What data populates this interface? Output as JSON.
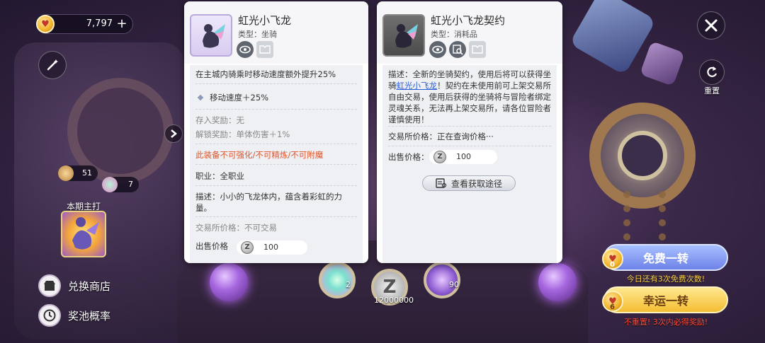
{
  "currency": {
    "icon": "cat-coin-icon",
    "value": "7,797",
    "plus": "+"
  },
  "top_right": {
    "reset_label": "重置"
  },
  "left_side": {
    "badge_a": "51",
    "badge_b": "7",
    "featured_label": "本期主打",
    "menu": [
      {
        "label": "兑换商店",
        "icon": "shop-icon"
      },
      {
        "label": "奖池概率",
        "icon": "clock-icon"
      }
    ]
  },
  "rewards": [
    {
      "label": "2",
      "icon": "rainbow-dragon-egg-icon"
    },
    {
      "label": "12000000",
      "icon": "z-coin-icon"
    },
    {
      "label": "90",
      "icon": "crystal-icon"
    }
  ],
  "spin": {
    "free_label": "免费一转",
    "free_count": "0",
    "free_hint": "今日还有3次免费次数!",
    "lucky_label": "幸运一转",
    "lucky_count": "6",
    "lucky_hint": "不重置! 3次内必得奖励!"
  },
  "panel_left": {
    "name": "虹光小飞龙",
    "type": "类型：坐骑",
    "effect_desc": "在主城内骑乘时移动速度额外提升25%",
    "stat": "移动速度＋25%",
    "deposit_reward": "存入奖励：无",
    "unlock_reward": "解锁奖励：单体伤害＋1%",
    "warning": "此装备不可强化/不可精炼/不可附魔",
    "job": "职业：全职业",
    "description": "描述：小小的飞龙体内，蕴含着彩虹的力量。",
    "trade_price": "交易所价格：不可交易",
    "sell_label": "出售价格",
    "sell_value": "100"
  },
  "panel_right": {
    "name": "虹光小飞龙契约",
    "type": "类型：消耗品",
    "desc_prefix": "描述：全新的坐骑契约，使用后将可以获得坐骑",
    "desc_link": "虹光小飞龙",
    "desc_suffix": "！契约在未使用前可上架交易所自由交易，使用后获得的坐骑将与冒险者绑定灵魂关系，无法再上架交易所，请各位冒险者谨慎使用！",
    "trade_price": "交易所价格：正在查询价格···",
    "sell_label": "出售价格：",
    "sell_value": "100",
    "source_button": "查看获取途径"
  },
  "colors": {
    "warning": "#e0542a",
    "link": "#2a5bd7",
    "free_hint": "#ffd24a",
    "lucky_hint": "#ff4a3a"
  }
}
